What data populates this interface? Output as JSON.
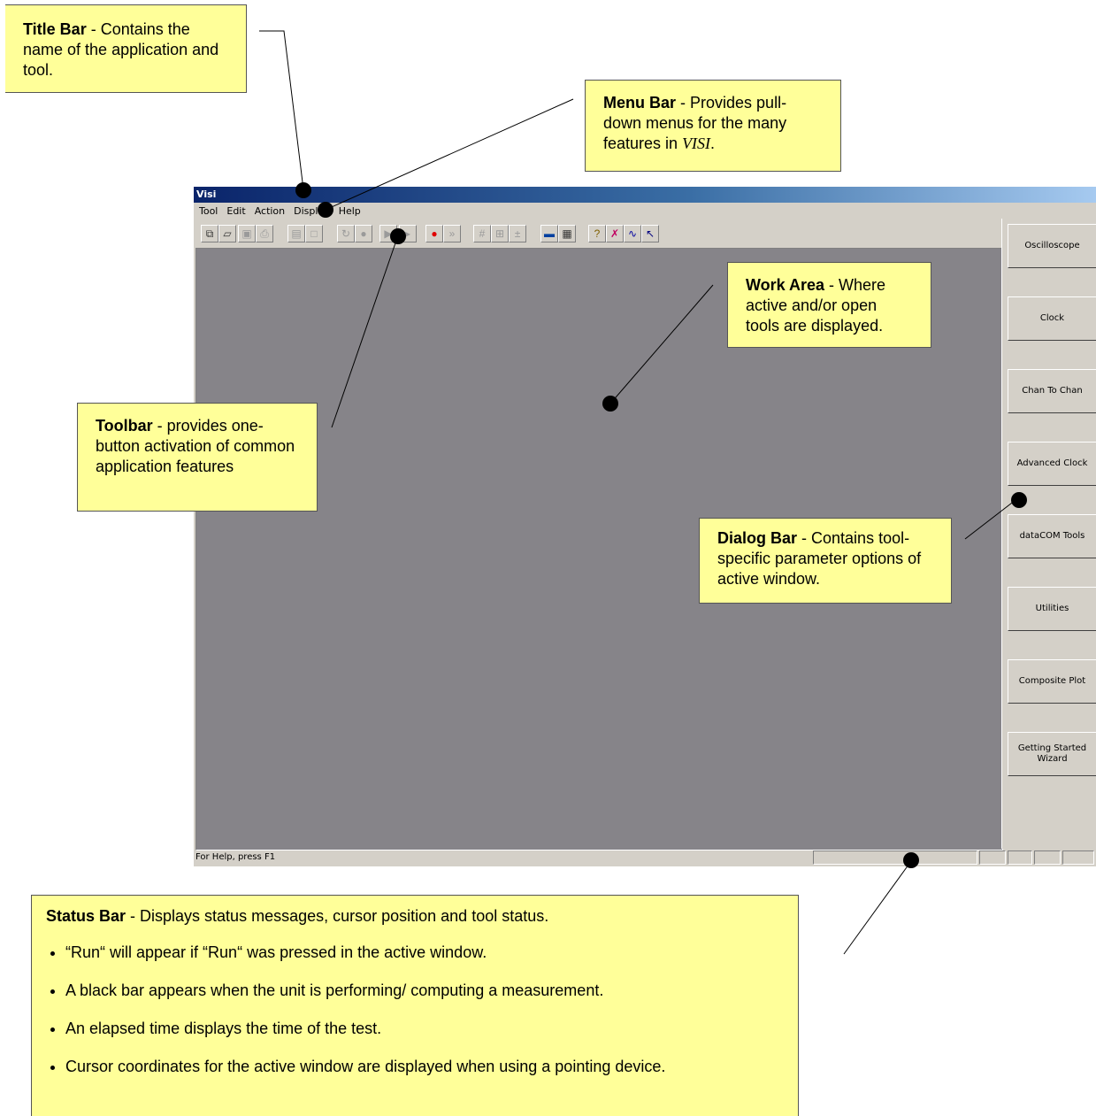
{
  "window": {
    "title": "Visi"
  },
  "menu": [
    "Tool",
    "Edit",
    "Action",
    "Display",
    "Help"
  ],
  "toolbar_icons": [
    "open-tool-icon",
    "open-file-icon",
    "save-icon",
    "print-icon",
    "copy-icon",
    "blank-icon",
    "refresh-icon",
    "stop-icon",
    "play-icon",
    "step-icon",
    "record-icon",
    "fast-forward-icon",
    "grid-icon",
    "zoom-icon",
    "marker-icon",
    "monitor-icon",
    "report-icon",
    "help-icon",
    "tool-icon",
    "chart-icon",
    "context-help-icon"
  ],
  "dialog_bar": [
    "Oscilloscope",
    "Clock",
    "Chan To Chan",
    "Advanced Clock",
    "dataCOM Tools",
    "Utilities",
    "Composite Plot",
    "Getting Started Wizard"
  ],
  "status": {
    "message": "For Help, press F1"
  },
  "annotations": {
    "title_bar": {
      "heading": "Title Bar",
      "text": " - Contains the name of the application and tool."
    },
    "menu_bar": {
      "heading": "Menu Bar",
      "text": " - Provides pull-down menus for the many features in ",
      "app": "VISI",
      "end": "."
    },
    "work_area": {
      "heading": "Work Area",
      "text": " - Where active and/or open tools are displayed."
    },
    "toolbar": {
      "heading": "Toolbar",
      "text": " - provides one-button activation of common application features"
    },
    "dialog_bar": {
      "heading": "Dialog Bar",
      "text": " - Contains tool-specific parameter options of active window."
    },
    "status_bar": {
      "heading": "Status Bar",
      "text": " - Displays status messages, cursor position and tool status.",
      "bullets": [
        "“Run“ will appear if “Run“ was pressed in the active window.",
        "A black bar appears when the unit is performing/ computing a  measurement.",
        "An elapsed time displays the time of the test.",
        "Cursor coordinates for the active window are displayed when using a pointing device."
      ]
    }
  }
}
